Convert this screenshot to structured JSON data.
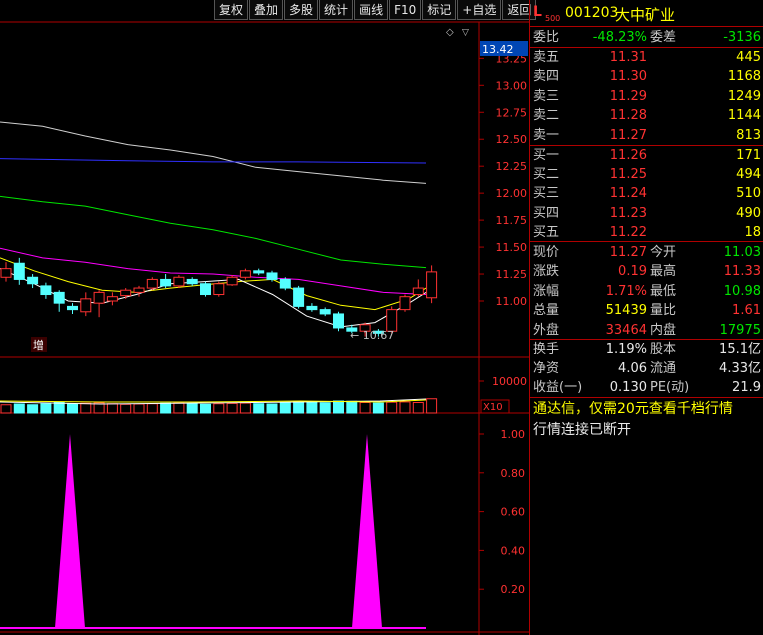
{
  "toolbar": [
    "复权",
    "叠加",
    "多股",
    "统计",
    "画线",
    "F10",
    "标记",
    "+自选",
    "返回"
  ],
  "stock": {
    "badge": "L",
    "sub": "500",
    "code": "001203",
    "name": "大中矿业"
  },
  "ratio": {
    "label": "委比",
    "value": "-48.23%",
    "label2": "委差",
    "value2": "-3136"
  },
  "asks": [
    {
      "label": "卖五",
      "price": "11.31",
      "vol": "445"
    },
    {
      "label": "卖四",
      "price": "11.30",
      "vol": "1168"
    },
    {
      "label": "卖三",
      "price": "11.29",
      "vol": "1249"
    },
    {
      "label": "卖二",
      "price": "11.28",
      "vol": "1144"
    },
    {
      "label": "卖一",
      "price": "11.27",
      "vol": "813"
    }
  ],
  "bids": [
    {
      "label": "买一",
      "price": "11.26",
      "vol": "171"
    },
    {
      "label": "买二",
      "price": "11.25",
      "vol": "494"
    },
    {
      "label": "买三",
      "price": "11.24",
      "vol": "510"
    },
    {
      "label": "买四",
      "price": "11.23",
      "vol": "490"
    },
    {
      "label": "买五",
      "price": "11.22",
      "vol": "18"
    }
  ],
  "quote": [
    {
      "l1": "现价",
      "v1": "11.27",
      "c1": "red",
      "l2": "今开",
      "v2": "11.03",
      "c2": "grn"
    },
    {
      "l1": "涨跌",
      "v1": "0.19",
      "c1": "red",
      "l2": "最高",
      "v2": "11.33",
      "c2": "red"
    },
    {
      "l1": "涨幅",
      "v1": "1.71%",
      "c1": "red",
      "l2": "最低",
      "v2": "10.98",
      "c2": "grn"
    },
    {
      "l1": "总量",
      "v1": "51439",
      "c1": "yel",
      "l2": "量比",
      "v2": "1.61",
      "c2": "red"
    },
    {
      "l1": "外盘",
      "v1": "33464",
      "c1": "red",
      "l2": "内盘",
      "v2": "17975",
      "c2": "grn"
    }
  ],
  "fin": [
    {
      "l1": "换手",
      "v1": "1.19%",
      "l2": "股本",
      "v2": "15.1亿"
    },
    {
      "l1": "净资",
      "v1": "4.06",
      "l2": "流通",
      "v2": "4.33亿"
    },
    {
      "l1": "收益(一)",
      "v1": "0.130",
      "l2": "PE(动)",
      "v2": "21.9"
    }
  ],
  "notice1": "通达信，仅需20元查看千档行情",
  "notice2": "行情连接已断开",
  "chart_labels": {
    "low_marker": "10.67",
    "zeng": "增",
    "vol_tick": "10000",
    "vol_unit": "X10",
    "price_highlight": "13.42"
  },
  "colors": {
    "up": "#ff3232",
    "down": "#54ffff",
    "ma5": "#ffffff",
    "ma10": "#ffff00",
    "ma20": "#ff00ff",
    "ma60": "#00e600",
    "ma120": "#3030ff",
    "ma250": "#d0d0d0",
    "indicator": "#ff00ff"
  },
  "chart_data": [
    {
      "type": "candlestick",
      "yticks": [
        "13.25",
        "13.00",
        "12.75",
        "12.50",
        "12.25",
        "12.00",
        "11.75",
        "11.50",
        "11.25",
        "11.00"
      ],
      "yrange": [
        10.6,
        13.42
      ],
      "low_marker": 10.67,
      "candles": [
        {
          "o": 11.22,
          "c": 11.3,
          "h": 11.36,
          "l": 11.18
        },
        {
          "o": 11.35,
          "c": 11.2,
          "h": 11.4,
          "l": 11.15
        },
        {
          "o": 11.22,
          "c": 11.16,
          "h": 11.25,
          "l": 11.12
        },
        {
          "o": 11.14,
          "c": 11.06,
          "h": 11.17,
          "l": 11.02
        },
        {
          "o": 11.08,
          "c": 10.98,
          "h": 11.1,
          "l": 10.9
        },
        {
          "o": 10.95,
          "c": 10.92,
          "h": 10.98,
          "l": 10.88
        },
        {
          "o": 10.9,
          "c": 11.02,
          "h": 11.08,
          "l": 10.86
        },
        {
          "o": 10.98,
          "c": 11.08,
          "h": 11.1,
          "l": 10.85
        },
        {
          "o": 11.0,
          "c": 11.04,
          "h": 11.08,
          "l": 10.96
        },
        {
          "o": 11.05,
          "c": 11.1,
          "h": 11.12,
          "l": 11.02
        },
        {
          "o": 11.08,
          "c": 11.12,
          "h": 11.14,
          "l": 11.04
        },
        {
          "o": 11.12,
          "c": 11.2,
          "h": 11.22,
          "l": 11.1
        },
        {
          "o": 11.2,
          "c": 11.14,
          "h": 11.25,
          "l": 11.12
        },
        {
          "o": 11.14,
          "c": 11.22,
          "h": 11.24,
          "l": 11.12
        },
        {
          "o": 11.2,
          "c": 11.16,
          "h": 11.22,
          "l": 11.14
        },
        {
          "o": 11.16,
          "c": 11.06,
          "h": 11.18,
          "l": 11.04
        },
        {
          "o": 11.06,
          "c": 11.16,
          "h": 11.18,
          "l": 11.04
        },
        {
          "o": 11.15,
          "c": 11.22,
          "h": 11.24,
          "l": 11.14
        },
        {
          "o": 11.22,
          "c": 11.28,
          "h": 11.3,
          "l": 11.2
        },
        {
          "o": 11.28,
          "c": 11.26,
          "h": 11.3,
          "l": 11.24
        },
        {
          "o": 11.26,
          "c": 11.2,
          "h": 11.28,
          "l": 11.18
        },
        {
          "o": 11.2,
          "c": 11.12,
          "h": 11.22,
          "l": 11.1
        },
        {
          "o": 11.12,
          "c": 10.95,
          "h": 11.14,
          "l": 10.93
        },
        {
          "o": 10.95,
          "c": 10.92,
          "h": 10.98,
          "l": 10.9
        },
        {
          "o": 10.92,
          "c": 10.88,
          "h": 10.94,
          "l": 10.86
        },
        {
          "o": 10.88,
          "c": 10.75,
          "h": 10.9,
          "l": 10.72
        },
        {
          "o": 10.75,
          "c": 10.72,
          "h": 10.78,
          "l": 10.7
        },
        {
          "o": 10.72,
          "c": 10.78,
          "h": 10.8,
          "l": 10.67
        },
        {
          "o": 10.72,
          "c": 10.7,
          "h": 10.74,
          "l": 10.67
        },
        {
          "o": 10.72,
          "c": 10.92,
          "h": 10.95,
          "l": 10.7
        },
        {
          "o": 10.92,
          "c": 11.04,
          "h": 11.06,
          "l": 10.9
        },
        {
          "o": 11.06,
          "c": 11.12,
          "h": 11.2,
          "l": 11.04
        },
        {
          "o": 11.03,
          "c": 11.27,
          "h": 11.33,
          "l": 10.98
        }
      ],
      "ma": [
        {
          "name": "ma250",
          "pts": [
            [
              0,
              12.66
            ],
            [
              5,
              12.62
            ],
            [
              10,
              12.53
            ],
            [
              15,
              12.45
            ],
            [
              20,
              12.4
            ],
            [
              25,
              12.34
            ],
            [
              30,
              12.24
            ],
            [
              35,
              12.2
            ],
            [
              40,
              12.16
            ],
            [
              45,
              12.12
            ],
            [
              50,
              12.09
            ]
          ]
        },
        {
          "name": "ma120",
          "pts": [
            [
              0,
              12.32
            ],
            [
              15,
              12.3
            ],
            [
              25,
              12.29
            ],
            [
              35,
              12.29
            ],
            [
              50,
              12.28
            ]
          ]
        },
        {
          "name": "ma60",
          "pts": [
            [
              0,
              11.97
            ],
            [
              5,
              11.92
            ],
            [
              10,
              11.88
            ],
            [
              15,
              11.8
            ],
            [
              20,
              11.72
            ],
            [
              25,
              11.66
            ],
            [
              30,
              11.58
            ],
            [
              35,
              11.48
            ],
            [
              40,
              11.38
            ],
            [
              45,
              11.34
            ],
            [
              50,
              11.31
            ]
          ]
        },
        {
          "name": "ma20",
          "pts": [
            [
              0,
              11.49
            ],
            [
              5,
              11.4
            ],
            [
              10,
              11.36
            ],
            [
              15,
              11.3
            ],
            [
              20,
              11.26
            ],
            [
              25,
              11.25
            ],
            [
              30,
              11.22
            ],
            [
              35,
              11.2
            ],
            [
              40,
              11.14
            ],
            [
              45,
              11.08
            ],
            [
              50,
              11.06
            ]
          ]
        },
        {
          "name": "ma10",
          "pts": [
            [
              0,
              11.4
            ],
            [
              4,
              11.28
            ],
            [
              8,
              11.18
            ],
            [
              12,
              11.1
            ],
            [
              16,
              11.08
            ],
            [
              20,
              11.12
            ],
            [
              24,
              11.15
            ],
            [
              28,
              11.18
            ],
            [
              32,
              11.2
            ],
            [
              36,
              11.05
            ],
            [
              40,
              10.96
            ],
            [
              44,
              10.92
            ],
            [
              48,
              11.02
            ],
            [
              50,
              11.12
            ]
          ]
        },
        {
          "name": "ma5",
          "pts": [
            [
              0,
              11.3
            ],
            [
              4,
              11.16
            ],
            [
              8,
              11.0
            ],
            [
              12,
              10.98
            ],
            [
              16,
              11.06
            ],
            [
              20,
              11.16
            ],
            [
              24,
              11.18
            ],
            [
              28,
              11.2
            ],
            [
              32,
              11.06
            ],
            [
              36,
              10.86
            ],
            [
              40,
              10.76
            ],
            [
              44,
              10.8
            ],
            [
              48,
              10.98
            ],
            [
              50,
              11.08
            ]
          ]
        }
      ],
      "volume": [
        0.55,
        0.6,
        0.55,
        0.62,
        0.7,
        0.6,
        0.65,
        0.68,
        0.62,
        0.58,
        0.6,
        0.62,
        0.65,
        0.66,
        0.6,
        0.58,
        0.62,
        0.64,
        0.66,
        0.62,
        0.6,
        0.7,
        0.75,
        0.72,
        0.68,
        0.8,
        0.78,
        0.7,
        0.66,
        0.72,
        0.74,
        0.7,
        0.95
      ]
    },
    {
      "type": "area",
      "yticks": [
        "1.00",
        "0.80",
        "0.60",
        "0.40",
        "0.20"
      ],
      "yrange": [
        0,
        1
      ],
      "spikes": [
        {
          "position": 70,
          "value": 1.0
        },
        {
          "position": 367,
          "value": 1.0
        }
      ]
    }
  ]
}
